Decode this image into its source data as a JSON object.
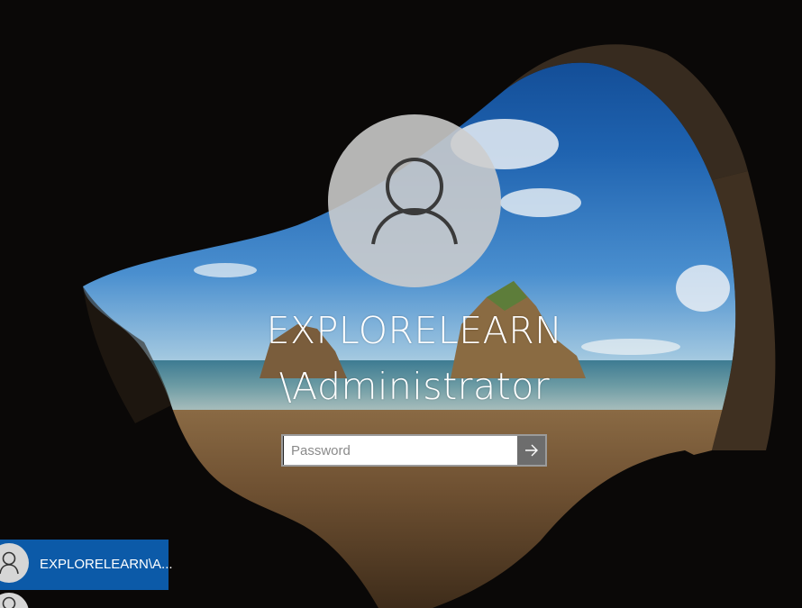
{
  "lock_screen": {
    "user_name_line1": "EXPLORELEARN",
    "user_name_line2": "\\Administrator",
    "password_placeholder": "Password"
  },
  "user_list": {
    "items": [
      {
        "label": "EXPLORELEARN\\A..."
      }
    ]
  },
  "colors": {
    "selected_tile": "#0c5aa8",
    "submit_button": "#6d6d6d",
    "avatar_background": "#cdcdcd"
  },
  "icons": {
    "avatar": "user-silhouette-icon",
    "submit": "arrow-right-icon"
  }
}
